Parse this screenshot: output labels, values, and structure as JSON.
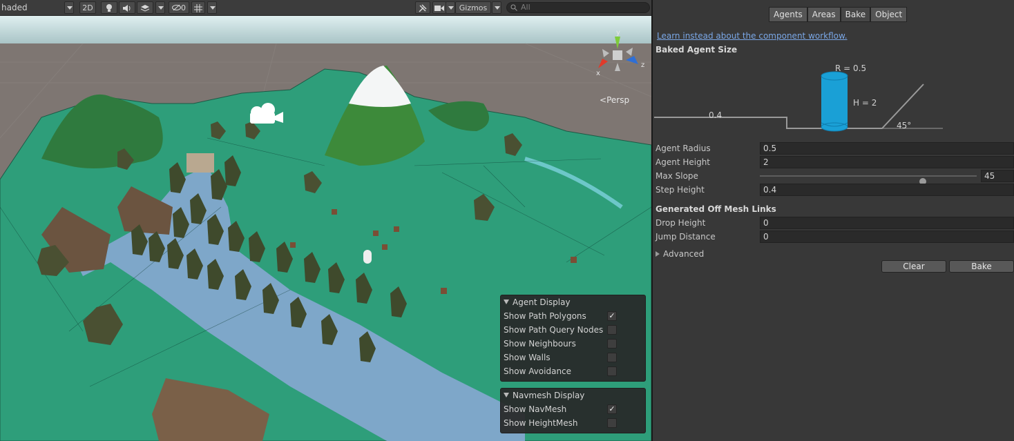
{
  "toolbar": {
    "shading_mode": "haded",
    "mode_2d": "2D",
    "hidden_count": "0",
    "gizmos": "Gizmos",
    "search_placeholder": "All"
  },
  "viewport": {
    "projection_label": "Persp",
    "gizmo_axes": {
      "x": "x",
      "y": "y",
      "z": "z"
    }
  },
  "agent_display": {
    "title": "Agent Display",
    "items": [
      {
        "label": "Show Path Polygons",
        "checked": true
      },
      {
        "label": "Show Path Query Nodes",
        "checked": false
      },
      {
        "label": "Show Neighbours",
        "checked": false
      },
      {
        "label": "Show Walls",
        "checked": false
      },
      {
        "label": "Show Avoidance",
        "checked": false
      }
    ]
  },
  "navmesh_display": {
    "title": "Navmesh Display",
    "items": [
      {
        "label": "Show NavMesh",
        "checked": true
      },
      {
        "label": "Show HeightMesh",
        "checked": false
      }
    ]
  },
  "inspector": {
    "tabs": [
      "Agents",
      "Areas",
      "Bake",
      "Object"
    ],
    "active_tab": "Bake",
    "workflow_link": "Learn instead about the component workflow.",
    "baked_agent_size": {
      "title": "Baked Agent Size",
      "radius_label": "R = 0.5",
      "height_label": "H = 2",
      "step_label": "0.4",
      "slope_label": "45°"
    },
    "fields": {
      "agent_radius": {
        "label": "Agent Radius",
        "value": "0.5"
      },
      "agent_height": {
        "label": "Agent Height",
        "value": "2"
      },
      "max_slope": {
        "label": "Max Slope",
        "value": "45",
        "fraction": 0.75
      },
      "step_height": {
        "label": "Step Height",
        "value": "0.4"
      }
    },
    "off_mesh": {
      "title": "Generated Off Mesh Links",
      "drop_height": {
        "label": "Drop Height",
        "value": "0"
      },
      "jump_distance": {
        "label": "Jump Distance",
        "value": "0"
      }
    },
    "advanced_label": "Advanced",
    "clear_button": "Clear",
    "bake_button": "Bake"
  }
}
